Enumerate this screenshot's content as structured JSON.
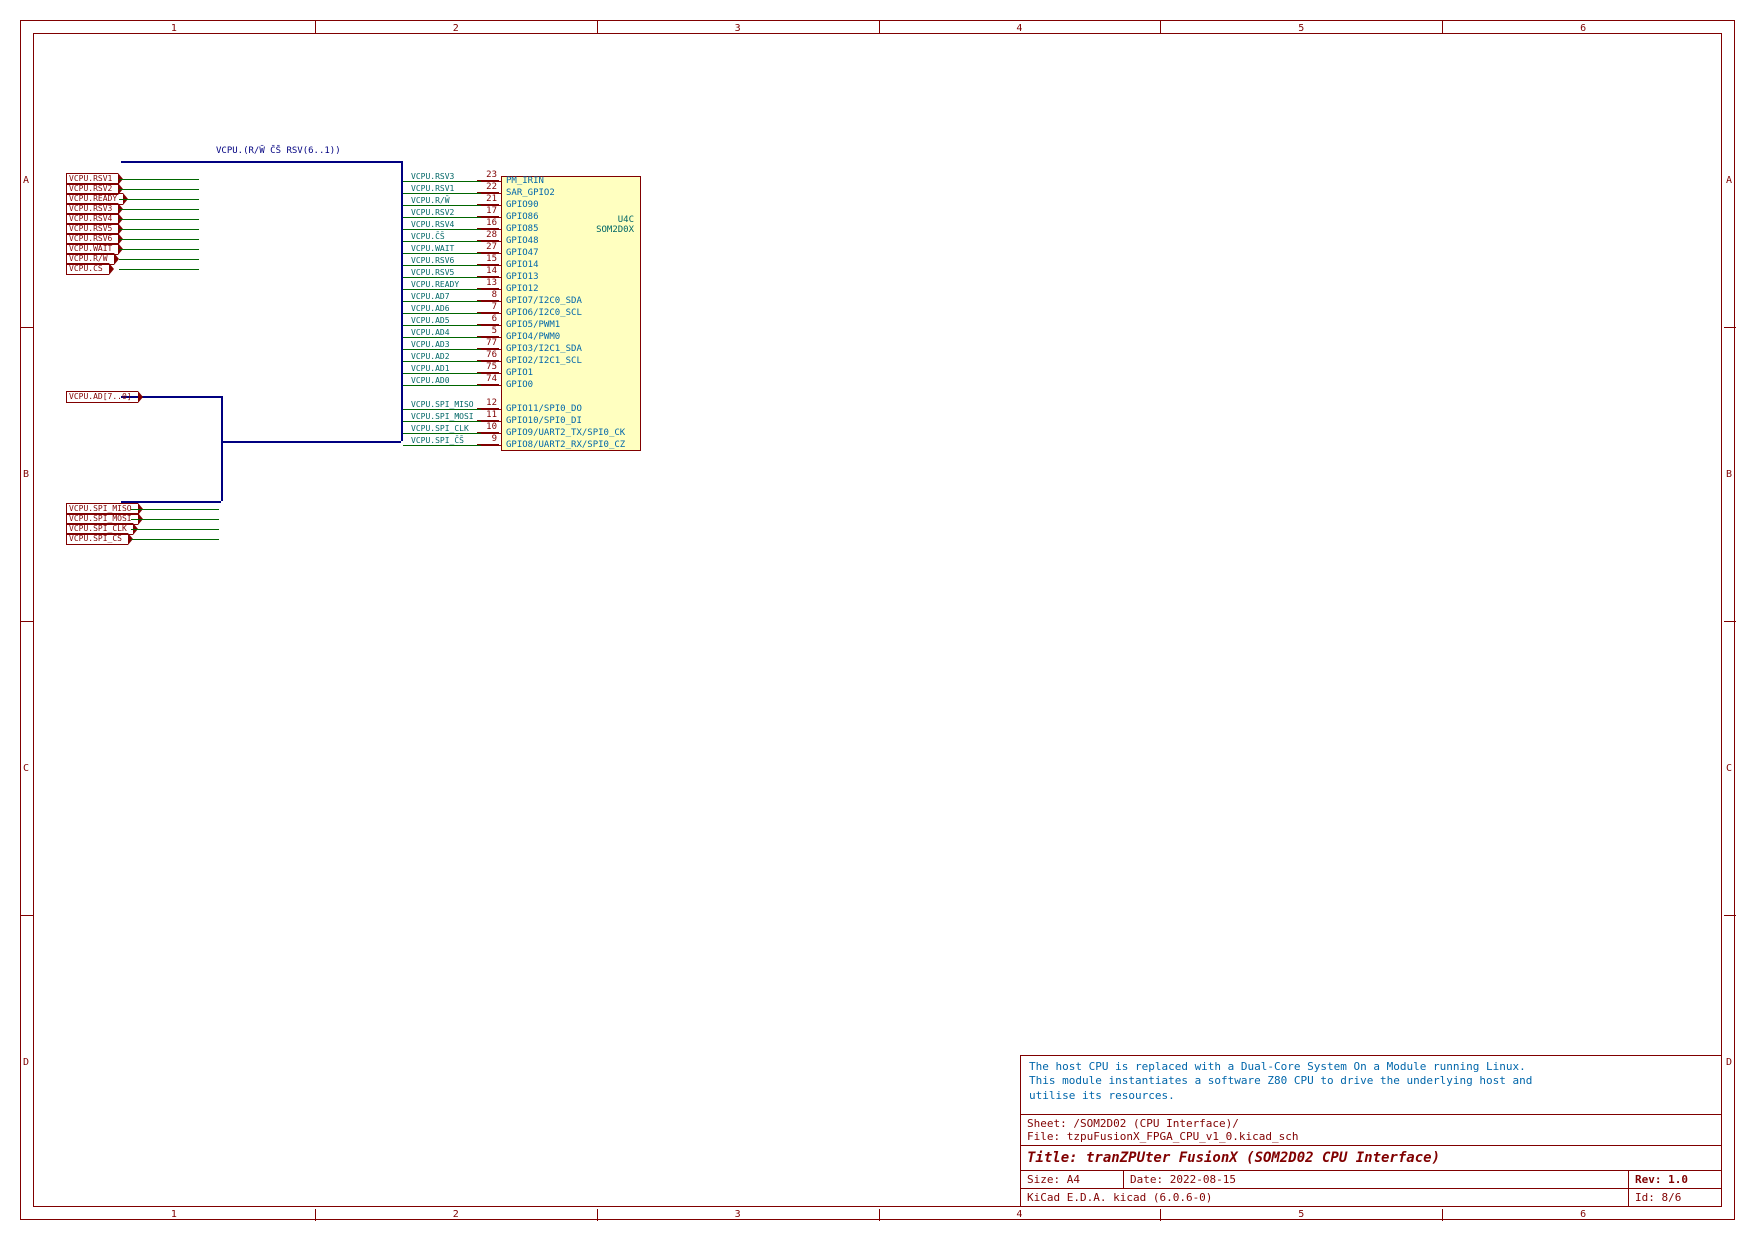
{
  "frame": {
    "cols": [
      "1",
      "2",
      "3",
      "4",
      "5",
      "6"
    ],
    "rows": [
      "A",
      "B",
      "C",
      "D"
    ]
  },
  "component": {
    "ref": "U4C",
    "value": "SOM2D0X",
    "pins": [
      {
        "num": "23",
        "name": "PM_IRIN",
        "signal": "VCPU.RSV3"
      },
      {
        "num": "22",
        "name": "SAR_GPIO2",
        "signal": "VCPU.RSV1"
      },
      {
        "num": "21",
        "name": "GPIO90",
        "signal": "VCPU.R/W̄"
      },
      {
        "num": "17",
        "name": "GPIO86",
        "signal": "VCPU.RSV2"
      },
      {
        "num": "16",
        "name": "GPIO85",
        "signal": "VCPU.RSV4"
      },
      {
        "num": "28",
        "name": "GPIO48",
        "signal": "VCPU.C̄S̄"
      },
      {
        "num": "27",
        "name": "GPIO47",
        "signal": "VCPU.WAIT"
      },
      {
        "num": "15",
        "name": "GPIO14",
        "signal": "VCPU.RSV6"
      },
      {
        "num": "14",
        "name": "GPIO13",
        "signal": "VCPU.RSV5"
      },
      {
        "num": "13",
        "name": "GPIO12",
        "signal": "VCPU.READY"
      },
      {
        "num": "8",
        "name": "GPIO7/I2C0_SDA",
        "signal": "VCPU.AD7"
      },
      {
        "num": "7",
        "name": "GPIO6/I2C0_SCL",
        "signal": "VCPU.AD6"
      },
      {
        "num": "6",
        "name": "GPIO5/PWM1",
        "signal": "VCPU.AD5"
      },
      {
        "num": "5",
        "name": "GPIO4/PWM0",
        "signal": "VCPU.AD4"
      },
      {
        "num": "77",
        "name": "GPIO3/I2C1_SDA",
        "signal": "VCPU.AD3"
      },
      {
        "num": "76",
        "name": "GPIO2/I2C1_SCL",
        "signal": "VCPU.AD2"
      },
      {
        "num": "75",
        "name": "GPIO1",
        "signal": "VCPU.AD1"
      },
      {
        "num": "74",
        "name": "GPIO0",
        "signal": "VCPU.AD0"
      },
      {
        "num": "",
        "name": "",
        "signal": ""
      },
      {
        "num": "12",
        "name": "GPIO11/SPI0_DO",
        "signal": "VCPU.SPI_MISO"
      },
      {
        "num": "11",
        "name": "GPIO10/SPI0_DI",
        "signal": "VCPU.SPI_MOSI"
      },
      {
        "num": "10",
        "name": "GPIO9/UART2_TX/SPI0_CK",
        "signal": "VCPU.SPI_CLK"
      },
      {
        "num": "9",
        "name": "GPIO8/UART2_RX/SPI0_CZ",
        "signal": "VCPU.SPI_C̄S̄"
      }
    ]
  },
  "hier_labels_top": [
    "VCPU.RSV1",
    "VCPU.RSV2",
    "VCPU.READY",
    "VCPU.RSV3",
    "VCPU.RSV4",
    "VCPU.RSV5",
    "VCPU.RSV6",
    "VCPU.WAIT",
    "VCPU.R/W̄",
    "VCPU.CS"
  ],
  "hier_labels_mid": [
    "VCPU.AD[7..0]"
  ],
  "hier_labels_bot": [
    "VCPU.SPI_MISO",
    "VCPU.SPI_MOSI",
    "VCPU.SPI_CLK",
    "VCPU.SPI_CS"
  ],
  "bus_label": "VCPU.(R/W̄ C̄S̄ RSV(6..1))",
  "titleblock": {
    "comment1": "The host CPU is replaced with a Dual-Core System On a Module running Linux.",
    "comment2": "This module instantiates a software Z80 CPU to drive the underlying host and",
    "comment3": "utilise its resources.",
    "sheet": "Sheet: /SOM2D02 (CPU Interface)/",
    "file": "File: tzpuFusionX_FPGA_CPU_v1_0.kicad_sch",
    "title": "Title: tranZPUter FusionX (SOM2D02 CPU Interface)",
    "size": "Size: A4",
    "date": "Date: 2022-08-15",
    "rev": "Rev: 1.0",
    "generator": "KiCad E.D.A.  kicad (6.0.6-0)",
    "id": "Id: 8/6"
  }
}
